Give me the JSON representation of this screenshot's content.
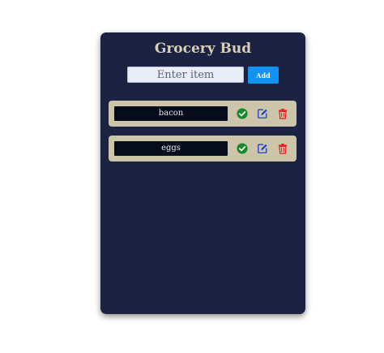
{
  "app": {
    "title": "Grocery Bud",
    "input": {
      "placeholder": "Enter item",
      "value": ""
    },
    "add_label": "Add"
  },
  "items": [
    {
      "name": "bacon"
    },
    {
      "name": "eggs"
    }
  ],
  "icons": {
    "check": "check-circle-icon",
    "edit": "edit-square-icon",
    "delete": "trash-icon"
  },
  "colors": {
    "panel": "#1c2342",
    "title": "#d8cfb6",
    "row": "#cdc5a9",
    "item_field": "#050c1c",
    "add_button": "#1293f3",
    "check": "#148a2c",
    "edit": "#1f40c8",
    "delete": "#e11f1f"
  }
}
